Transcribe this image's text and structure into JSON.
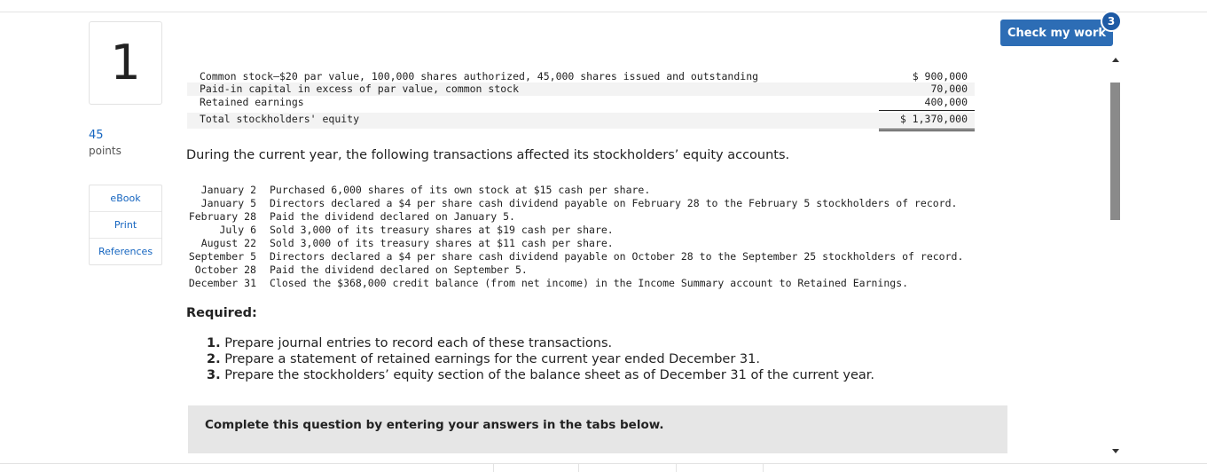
{
  "question": {
    "number": "1",
    "points_value": "45",
    "points_label": "points"
  },
  "tools": [
    "eBook",
    "Print",
    "References"
  ],
  "balance_sheet": {
    "rows": [
      {
        "label": "Common stock—$20 par value, 100,000 shares authorized, 45,000 shares issued and outstanding",
        "value": "$ 900,000"
      },
      {
        "label": "Paid-in capital in excess of par value, common stock",
        "value": "70,000"
      },
      {
        "label": "Retained earnings",
        "value": "400,000"
      },
      {
        "label": "Total stockholders' equity",
        "value": "$ 1,370,000"
      }
    ]
  },
  "intro": "During the current year, the following transactions affected its stockholders’ equity accounts.",
  "transactions": [
    {
      "date": "January 2",
      "desc": "Purchased 6,000 shares of its own stock at $15 cash per share."
    },
    {
      "date": "January 5",
      "desc": "Directors declared a $4 per share cash dividend payable on February 28 to the February 5 stockholders of record."
    },
    {
      "date": "February 28",
      "desc": "Paid the dividend declared on January 5."
    },
    {
      "date": "July 6",
      "desc": "Sold 3,000 of its treasury shares at $19 cash per share."
    },
    {
      "date": "August 22",
      "desc": "Sold 3,000 of its treasury shares at $11 cash per share."
    },
    {
      "date": "September 5",
      "desc": "Directors declared a $4 per share cash dividend payable on October 28 to the September 25 stockholders of record."
    },
    {
      "date": "October 28",
      "desc": "Paid the dividend declared on September 5."
    },
    {
      "date": "December 31",
      "desc": "Closed the $368,000 credit balance (from net income) in the Income Summary account to Retained Earnings."
    }
  ],
  "required": {
    "title": "Required:",
    "items": [
      {
        "num": "1.",
        "text": "Prepare journal entries to record each of these transactions."
      },
      {
        "num": "2.",
        "text": "Prepare a statement of retained earnings for the current year ended December 31."
      },
      {
        "num": "3.",
        "text": "Prepare the stockholders’ equity section of the balance sheet as of December 31 of the current year."
      }
    ]
  },
  "complete_box": "Complete this question by entering your answers in the tabs below.",
  "check_work": {
    "label": "Check my work",
    "badge": "3"
  },
  "colors": {
    "button": "#2d6db5",
    "badge": "#1e5aa5",
    "link": "#1565c0"
  }
}
